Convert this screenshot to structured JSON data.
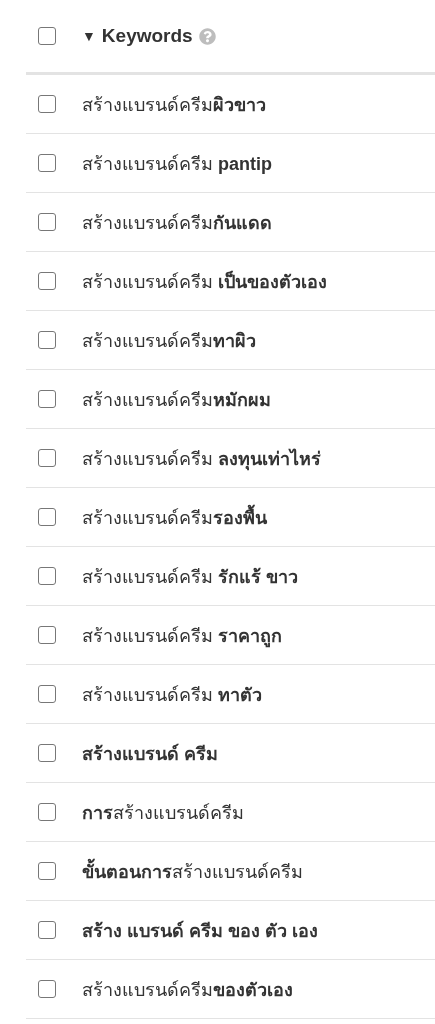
{
  "header": {
    "checked": false,
    "toggle": "▼",
    "label": "Keywords",
    "expanded": true
  },
  "keywords": [
    {
      "text": "สร้างแบรนด์ครีม**ผิวขาว**",
      "checked": false
    },
    {
      "text": "สร้างแบรนด์ครีม **pantip**",
      "checked": false
    },
    {
      "text": "สร้างแบรนด์ครีม**กันแดด**",
      "checked": false
    },
    {
      "text": "สร้างแบรนด์ครีม **เป็นของตัวเอง**",
      "checked": false
    },
    {
      "text": "สร้างแบรนด์ครีม**ทาผิว**",
      "checked": false
    },
    {
      "text": "สร้างแบรนด์ครีม**หมักผม**",
      "checked": false
    },
    {
      "text": "สร้างแบรนด์ครีม **ลงทุนเท่าไหร่**",
      "checked": false
    },
    {
      "text": "สร้างแบรนด์ครีม**รองพื้น**",
      "checked": false
    },
    {
      "text": "สร้างแบรนด์ครีม **รักแร้ ขาว**",
      "checked": false
    },
    {
      "text": "สร้างแบรนด์ครีม **ราคาถูก**",
      "checked": false
    },
    {
      "text": "สร้างแบรนด์ครีม **ทาตัว**",
      "checked": false
    },
    {
      "text": "**สร้างแบรนด์ ครีม**",
      "checked": false
    },
    {
      "text": "**การ**สร้างแบรนด์ครีม",
      "checked": false
    },
    {
      "text": "**ขั้นตอนการ**สร้างแบรนด์ครีม",
      "checked": false
    },
    {
      "text": "**สร้าง แบรนด์ ครีม ของ ตัว เอง**",
      "checked": false
    },
    {
      "text": "สร้างแบรนด์ครีม**ของตัวเอง**",
      "checked": false
    }
  ]
}
